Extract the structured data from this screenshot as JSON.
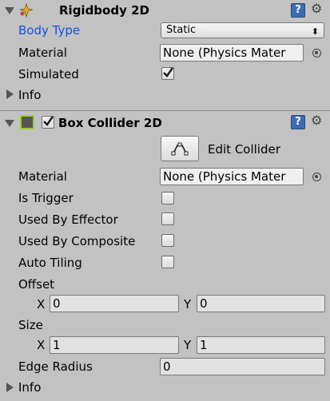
{
  "rigidbody": {
    "title": "Rigidbody 2D",
    "enabled": true,
    "fields": {
      "body_type_label": "Body Type",
      "body_type_value": "Static",
      "material_label": "Material",
      "material_value": "None (Physics Mater",
      "simulated_label": "Simulated",
      "simulated_checked": true,
      "info_label": "Info"
    }
  },
  "collider": {
    "title": "Box Collider 2D",
    "enabled": true,
    "edit_collider_label": "Edit Collider",
    "fields": {
      "material_label": "Material",
      "material_value": "None (Physics Mater",
      "is_trigger_label": "Is Trigger",
      "is_trigger_checked": false,
      "used_by_effector_label": "Used By Effector",
      "used_by_effector_checked": false,
      "used_by_composite_label": "Used By Composite",
      "used_by_composite_checked": false,
      "auto_tiling_label": "Auto Tiling",
      "auto_tiling_checked": false,
      "offset_label": "Offset",
      "offset_x_label": "X",
      "offset_x": "0",
      "offset_y_label": "Y",
      "offset_y": "0",
      "size_label": "Size",
      "size_x_label": "X",
      "size_x": "1",
      "size_y_label": "Y",
      "size_y": "1",
      "edge_radius_label": "Edge Radius",
      "edge_radius": "0",
      "info_label": "Info"
    }
  },
  "colors": {
    "background": "#c2c2c2",
    "highlight_label": "#1b4fd6",
    "checkmark": "#1a1a1a"
  }
}
